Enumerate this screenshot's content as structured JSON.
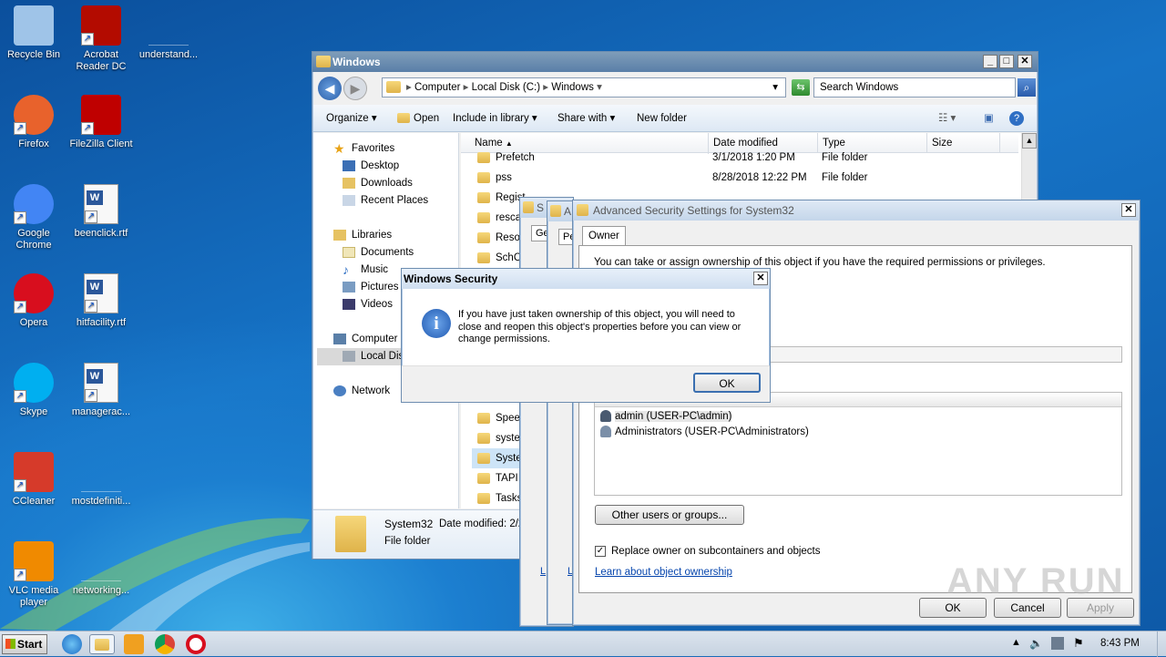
{
  "desktop_icons": [
    {
      "label": "Recycle Bin",
      "icon": "recycle-bin-icon"
    },
    {
      "label": "Acrobat Reader DC",
      "icon": "acrobat-icon"
    },
    {
      "label": "understand...",
      "icon": "blank-file-icon"
    },
    {
      "label": "Firefox",
      "icon": "firefox-icon"
    },
    {
      "label": "FileZilla Client",
      "icon": "filezilla-icon"
    },
    {
      "label": "Google Chrome",
      "icon": "chrome-icon"
    },
    {
      "label": "beenclick.rtf",
      "icon": "word-doc-icon"
    },
    {
      "label": "Opera",
      "icon": "opera-icon"
    },
    {
      "label": "hitfacility.rtf",
      "icon": "word-doc-icon"
    },
    {
      "label": "Skype",
      "icon": "skype-icon"
    },
    {
      "label": "managerac...",
      "icon": "word-doc-icon"
    },
    {
      "label": "CCleaner",
      "icon": "ccleaner-icon"
    },
    {
      "label": "mostdefiniti...",
      "icon": "blank-file-icon"
    },
    {
      "label": "VLC media player",
      "icon": "vlc-icon"
    },
    {
      "label": "networking...",
      "icon": "blank-file-icon"
    }
  ],
  "explorer": {
    "title": "Windows",
    "breadcrumb": [
      "Computer",
      "Local Disk (C:)",
      "Windows"
    ],
    "search_placeholder": "Search Windows",
    "toolbar": {
      "organize": "Organize",
      "open": "Open",
      "include": "Include in library",
      "share": "Share with",
      "new_folder": "New folder"
    },
    "columns": {
      "name": "Name",
      "date": "Date modified",
      "type": "Type",
      "size": "Size"
    },
    "nav": {
      "favorites": "Favorites",
      "desktop": "Desktop",
      "downloads": "Downloads",
      "recent": "Recent Places",
      "libraries": "Libraries",
      "documents": "Documents",
      "music": "Music",
      "pictures": "Pictures",
      "videos": "Videos",
      "computer": "Computer",
      "local_disk": "Local Dis",
      "network": "Network"
    },
    "rows": [
      {
        "name": "Prefetch",
        "date": "3/1/2018 1:20 PM",
        "type": "File folder"
      },
      {
        "name": "pss",
        "date": "8/28/2018 12:22 PM",
        "type": "File folder"
      },
      {
        "name": "Regist",
        "date": "",
        "type": ""
      },
      {
        "name": "rescac",
        "date": "",
        "type": ""
      },
      {
        "name": "Resou",
        "date": "",
        "type": ""
      },
      {
        "name": "SchCa",
        "date": "",
        "type": ""
      },
      {
        "name": "Speec",
        "date": "",
        "type": ""
      },
      {
        "name": "syster",
        "date": "",
        "type": ""
      },
      {
        "name": "Syste",
        "date": "",
        "type": ""
      },
      {
        "name": "TAPI",
        "date": "",
        "type": ""
      },
      {
        "name": "Tasks",
        "date": "",
        "type": ""
      }
    ],
    "details": {
      "name": "System32",
      "date_label": "Date modified: 2/2",
      "type": "File folder"
    }
  },
  "back_dialogs": {
    "tab1": "Ge",
    "tab2": "Pe",
    "frag1": "S",
    "frag2": "A"
  },
  "adv": {
    "title": "Advanced Security Settings for System32",
    "tab_owner": "Owner",
    "intro": "You can take or assign ownership of this object if you have the required permissions or privileges.",
    "owners": [
      "admin (USER-PC\\admin)",
      "Administrators (USER-PC\\Administrators)"
    ],
    "other_users_button": "Other users or groups...",
    "replace_checkbox": "Replace owner on subcontainers and objects",
    "learn_link": "Learn about object ownership",
    "ok": "OK",
    "cancel": "Cancel",
    "apply": "Apply",
    "frag_left1": "L",
    "frag_left2": "L"
  },
  "security_dialog": {
    "title": "Windows Security",
    "message": "If you have just taken ownership of this object, you will need to close and reopen this object's properties before you can view or change permissions.",
    "ok": "OK"
  },
  "taskbar": {
    "start": "Start",
    "time": "8:43 PM"
  },
  "watermark": "ANY RUN"
}
